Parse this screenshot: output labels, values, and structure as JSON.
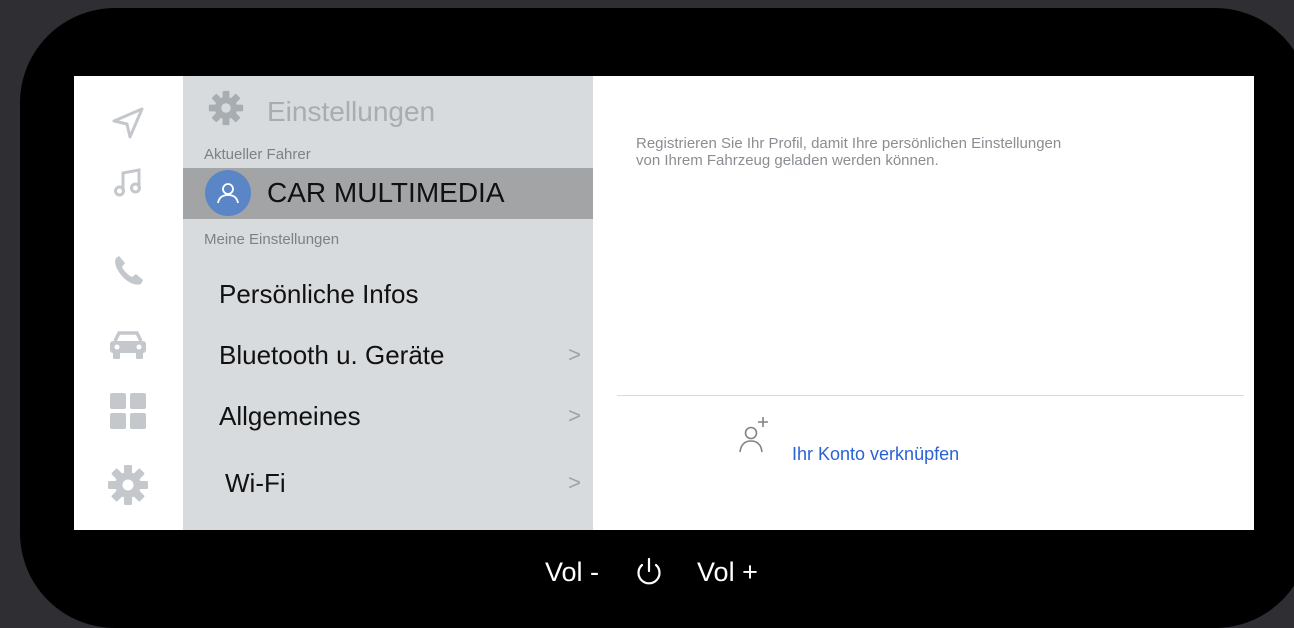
{
  "rail": {
    "icons": [
      "navigation-icon",
      "music-icon",
      "phone-icon",
      "car-icon",
      "apps-grid-icon",
      "settings-gear-icon"
    ]
  },
  "panel": {
    "title": "Einstellungen",
    "current_driver_label": "Aktueller Fahrer",
    "driver_name": "CAR MULTIMEDIA",
    "my_settings_label": "Meine Einstellungen",
    "items": [
      {
        "label": "Persönliche Infos",
        "chevron": ""
      },
      {
        "label": "Bluetooth u. Geräte",
        "chevron": ">"
      },
      {
        "label": "Allgemeines",
        "chevron": ">"
      },
      {
        "label": "Wi-Fi",
        "chevron": ">"
      }
    ]
  },
  "content": {
    "description": "Registrieren Sie Ihr Profil, damit Ihre persönlichen Einstellungen von Ihrem Fahrzeug geladen werden können.",
    "link_account": "Ihr Konto verknüpfen"
  },
  "controls": {
    "vol_down": "Vol -",
    "vol_up": "Vol +"
  },
  "colors": {
    "accent": "#2a62d4",
    "avatar": "#5a86c8",
    "panel_bg": "#d8dbdd",
    "selected_row": "#a3a4a6"
  }
}
